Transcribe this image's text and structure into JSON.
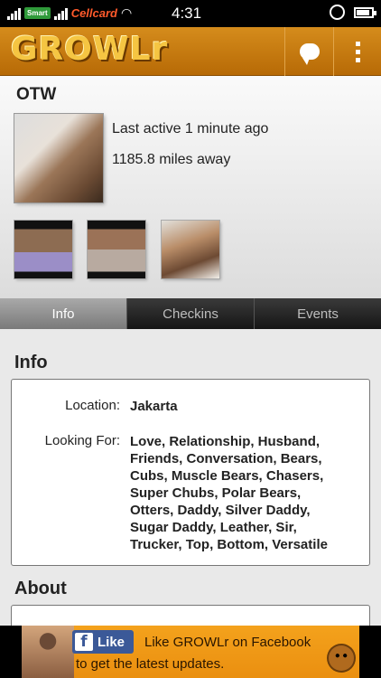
{
  "status_bar": {
    "carrier_smart": "Smart",
    "carrier_cellcard": "Cellcard",
    "time": "4:31"
  },
  "app_bar": {
    "logo": "GROWLr",
    "icons": [
      "chat-icon",
      "overflow-menu-icon"
    ]
  },
  "profile": {
    "name": "OTW",
    "last_active": "Last active 1 minute ago",
    "distance": "1185.8 miles away"
  },
  "tabs": [
    {
      "label": "Info",
      "active": true
    },
    {
      "label": "Checkins",
      "active": false
    },
    {
      "label": "Events",
      "active": false
    }
  ],
  "info": {
    "title": "Info",
    "location_label": "Location:",
    "location_value": "Jakarta",
    "looking_label": "Looking For:",
    "looking_value": "Love, Relationship, Husband, Friends, Conversation, Bears, Cubs, Muscle Bears, Chasers, Super Chubs, Polar Bears, Otters, Daddy, Silver Daddy, Sugar Daddy, Leather, Sir, Trucker, Top, Bottom, Versatile"
  },
  "about": {
    "title": "About"
  },
  "ad": {
    "like_button": "Like",
    "line1": "Like GROWLr on Facebook",
    "line2": "to get the latest updates."
  }
}
